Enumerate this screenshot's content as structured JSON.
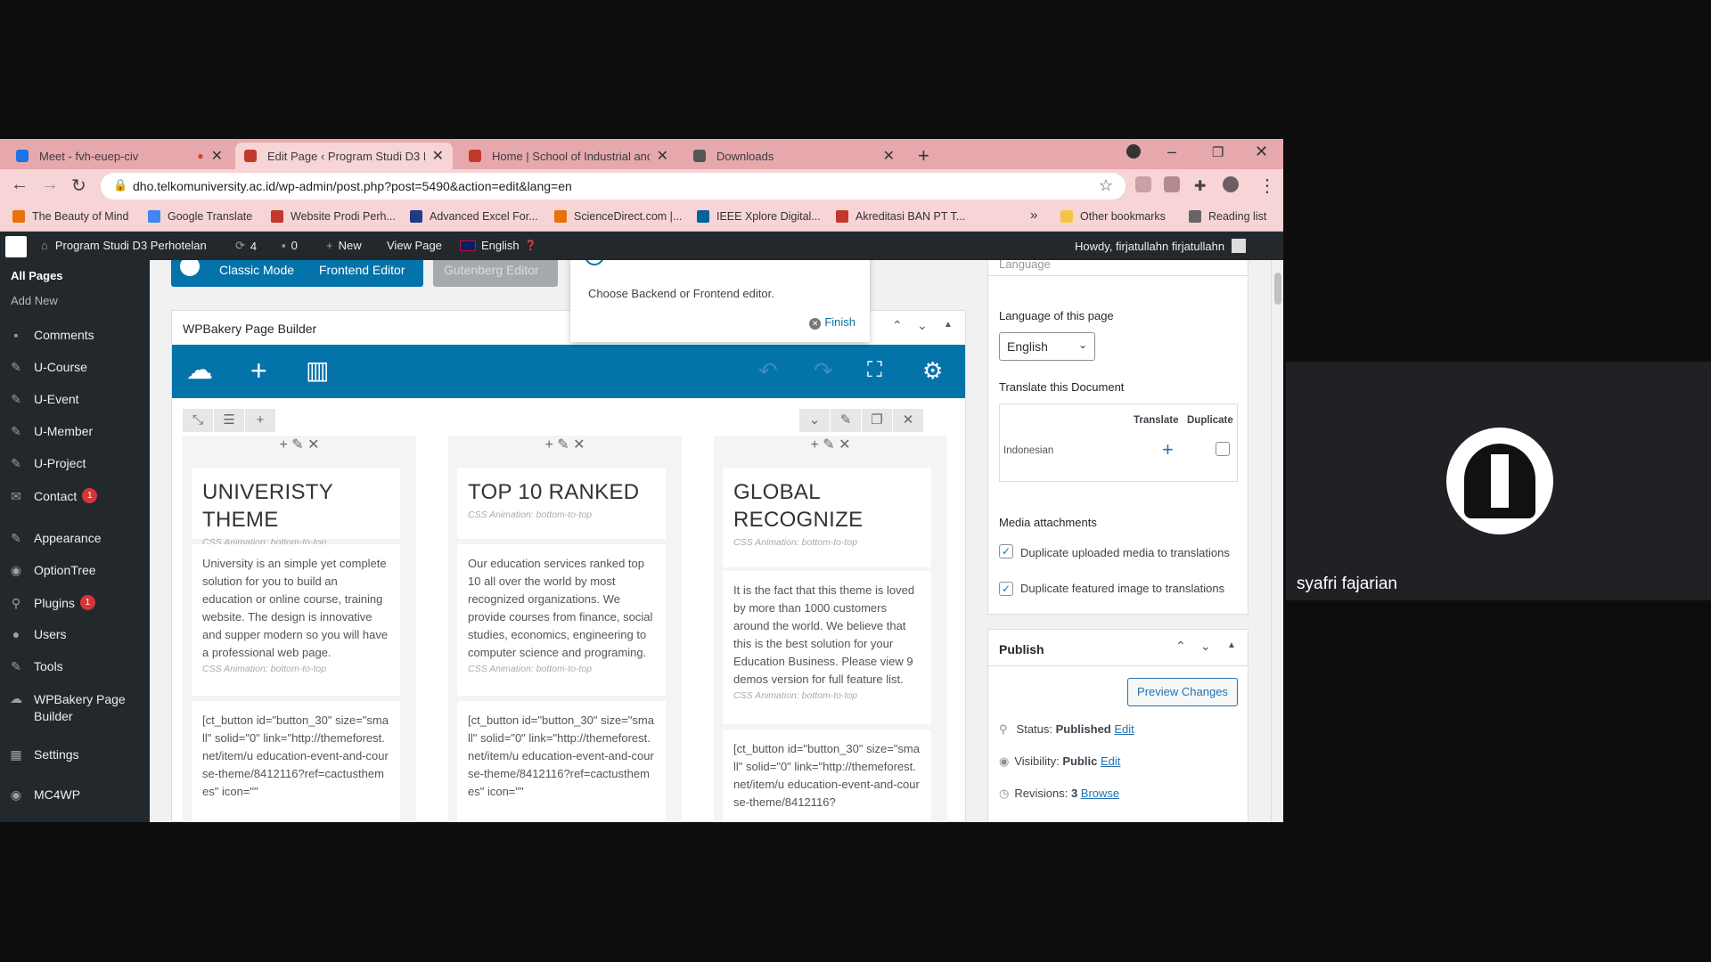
{
  "browser": {
    "tabs": [
      {
        "title": "Meet - fvh-euep-civ",
        "favicon_color": "#1a73e8",
        "active": false
      },
      {
        "title": "Edit Page ‹ Program Studi D3 Pe",
        "favicon_color": "#c0392b",
        "active": true
      },
      {
        "title": "Home | School of Industrial and",
        "favicon_color": "#c0392b",
        "active": false
      },
      {
        "title": "Downloads",
        "favicon_color": "#555555",
        "active": false
      }
    ],
    "url": "dho.telkomuniversity.ac.id/wp-admin/post.php?post=5490&action=edit&lang=en",
    "bookmarks": [
      "The Beauty of Mind",
      "Google Translate",
      "Website Prodi Perh...",
      "Advanced Excel For...",
      "ScienceDirect.com |...",
      "IEEE Xplore Digital...",
      "Akreditasi BAN PT T..."
    ],
    "bookmarks_overflow": "»",
    "other_bookmarks": "Other bookmarks",
    "reading_list": "Reading list"
  },
  "adminbar": {
    "site_name": "Program Studi D3 Perhotelan",
    "updates_count": "4",
    "comments_count": "0",
    "new_label": "New",
    "view_page": "View Page",
    "language": "English",
    "howdy": "Howdy, firjatullahn firjatullahn"
  },
  "sidebar": {
    "sub_items": [
      "All Pages",
      "Add New"
    ],
    "items": [
      {
        "label": "Comments",
        "badge": ""
      },
      {
        "label": "U-Course",
        "badge": ""
      },
      {
        "label": "U-Event",
        "badge": ""
      },
      {
        "label": "U-Member",
        "badge": ""
      },
      {
        "label": "U-Project",
        "badge": ""
      },
      {
        "label": "Contact",
        "badge": "1"
      },
      {
        "label": "Appearance",
        "badge": ""
      },
      {
        "label": "OptionTree",
        "badge": ""
      },
      {
        "label": "Plugins",
        "badge": "1"
      },
      {
        "label": "Users",
        "badge": ""
      },
      {
        "label": "Tools",
        "badge": ""
      },
      {
        "label": "WPBakery Page",
        "badge": ""
      },
      {
        "label": "Builder",
        "badge": ""
      },
      {
        "label": "Settings",
        "badge": ""
      },
      {
        "label": "MC4WP",
        "badge": ""
      }
    ]
  },
  "editor": {
    "classic_mode": "Classic Mode",
    "frontend_editor": "Frontend Editor",
    "gutenberg_editor": "Gutenberg Editor",
    "panel_title": "WPBakery Page Builder",
    "popover_text": "Choose Backend or Frontend editor.",
    "popover_finish": "Finish",
    "columns": [
      {
        "title": "UNIVERISTY THEME",
        "anim1": "CSS Animation: bottom-to-top",
        "text": "University is an simple yet complete solution for you to build an education or online course, training website. The design is innovative and supper modern so you will have a professional web page.",
        "anim2": "CSS Animation: bottom-to-top",
        "code": "[ct_button id=\"button_30\" size=\"small\" solid=\"0\" link=\"http://themeforest.net/item/u education-event-and-course-theme/8412116?ref=cactusthemes\" icon=\"\""
      },
      {
        "title": "TOP 10 RANKED",
        "anim1": "CSS Animation: bottom-to-top",
        "text": "Our education services ranked top 10 all over the world by most recognized organizations. We provide courses from finance, social studies, economics, engineering to computer science and programing.",
        "anim2": "CSS Animation: bottom-to-top",
        "code": "[ct_button id=\"button_30\" size=\"small\" solid=\"0\" link=\"http://themeforest.net/item/u education-event-and-course-theme/8412116?ref=cactusthemes\" icon=\"\""
      },
      {
        "title": "GLOBAL RECOGNIZE",
        "anim1": "CSS Animation: bottom-to-top",
        "text": "It is the fact that this theme is loved by more than 1000 customers around the world. We believe that this is the best solution for your Education Business. Please view 9 demos version for full feature list.",
        "anim2": "CSS Animation: bottom-to-top",
        "code": "[ct_button id=\"button_30\" size=\"small\" solid=\"0\" link=\"http://themeforest.net/item/u education-event-and-course-theme/8412116?"
      }
    ]
  },
  "language_box": {
    "header": "Language",
    "lang_label": "Language of this page",
    "lang_value": "English",
    "translate_doc": "Translate this Document",
    "col_translate": "Translate",
    "col_duplicate": "Duplicate",
    "row_lang": "Indonesian",
    "media_label": "Media attachments",
    "dup_media": "Duplicate uploaded media to translations",
    "dup_featured": "Duplicate featured image to translations"
  },
  "publish": {
    "title": "Publish",
    "preview": "Preview Changes",
    "status_label": "Status:",
    "status_value": "Published",
    "visibility_label": "Visibility:",
    "visibility_value": "Public",
    "revisions_label": "Revisions:",
    "revisions_value": "3",
    "edit": "Edit",
    "browse": "Browse"
  },
  "meet": {
    "participant_name": "syafri fajarian"
  },
  "colors": {
    "wpbakery_blue": "#0473aa",
    "admin_dark": "#23282d",
    "tab_strip": "#e6a8ad",
    "badge_red": "#d63638",
    "link_blue": "#2271b1"
  }
}
